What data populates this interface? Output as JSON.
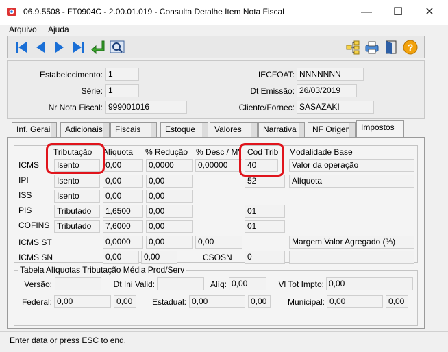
{
  "window": {
    "title": "06.9.5508 - FT0904C - 2.00.01.019 - Consulta Detalhe Item Nota Fiscal",
    "minimize": "—",
    "maximize": "☐",
    "close": "✕"
  },
  "menu": [
    "Arquivo",
    "Ajuda"
  ],
  "toolbar": {
    "icons": [
      "first-icon",
      "prev-icon",
      "next-icon",
      "last-icon",
      "goto-icon",
      "zoom-icon",
      "tree-icon",
      "print-icon",
      "exit-icon",
      "help-icon"
    ]
  },
  "header": {
    "estabelecimento_label": "Estabelecimento:",
    "estabelecimento": "1",
    "serie_label": "Série:",
    "serie": "1",
    "nr_nota_label": "Nr Nota Fiscal:",
    "nr_nota": "999001016",
    "iecfoat_label": "IECFOAT:",
    "iecfoat": "NNNNNNN",
    "dt_emissao_label": "Dt Emissão:",
    "dt_emissao": "26/03/2019",
    "cliente_label": "Cliente/Fornec:",
    "cliente": "SASAZAKI"
  },
  "tabs": [
    "Inf. Gerais",
    "Adicionais",
    "Fiscais",
    "Estoque",
    "Valores",
    "Narrativa",
    "NF Origem",
    "Impostos"
  ],
  "impostos": {
    "headers": {
      "tributacao": "Tributação",
      "aliquota": "Alíquota",
      "reducao": "% Redução",
      "desc": "% Desc / MVA",
      "cod_trib": "Cod Trib",
      "modalidade": "Modalidade Base"
    },
    "rows": {
      "icms": {
        "label": "ICMS",
        "tributacao": "Isento",
        "aliquota": "0,00",
        "reducao": "0,0000",
        "desc": "0,00000",
        "cod_trib": "40",
        "modalidade": "Valor da operação"
      },
      "ipi": {
        "label": "IPI",
        "tributacao": "Isento",
        "aliquota": "0,00",
        "reducao": "0,00",
        "cod_trib": "52",
        "modalidade": "Alíquota"
      },
      "iss": {
        "label": "ISS",
        "tributacao": "Isento",
        "aliquota": "0,00",
        "reducao": "0,00"
      },
      "pis": {
        "label": "PIS",
        "tributacao": "Tributado",
        "aliquota": "1,6500",
        "reducao": "0,00",
        "cod_trib": "01"
      },
      "cofins": {
        "label": "COFINS",
        "tributacao": "Tributado",
        "aliquota": "7,6000",
        "reducao": "0,00",
        "cod_trib": "01"
      },
      "icms_st": {
        "label": "ICMS ST",
        "aliquota": "0,0000",
        "reducao": "0,00",
        "desc": "0,00",
        "modalidade": "Margem Valor Agregado (%)"
      },
      "icms_sn": {
        "label": "ICMS SN",
        "v1": "0,00",
        "v2": "0,00",
        "csosn_label": "CSOSN",
        "csosn": "0"
      }
    }
  },
  "tabela": {
    "title": "Tabela Alíquotas Tributação Média Prod/Serv",
    "versao_label": "Versão:",
    "versao": "",
    "dt_ini_label": "Dt Ini Valid:",
    "dt_ini": "",
    "aliq_label": "Alíq:",
    "aliq": "0,00",
    "vl_tot_label": "Vl Tot Impto:",
    "vl_tot": "0,00",
    "federal_label": "Federal:",
    "federal": "0,00",
    "federal2": "0,00",
    "estadual_label": "Estadual:",
    "estadual": "0,00",
    "estadual2": "0,00",
    "municipal_label": "Municipal:",
    "municipal": "0,00",
    "municipal2": "0,00"
  },
  "status": "Enter data or press ESC to end.",
  "colors": {
    "highlight": "#e0141c",
    "nav_blue": "#1a6fd6"
  }
}
